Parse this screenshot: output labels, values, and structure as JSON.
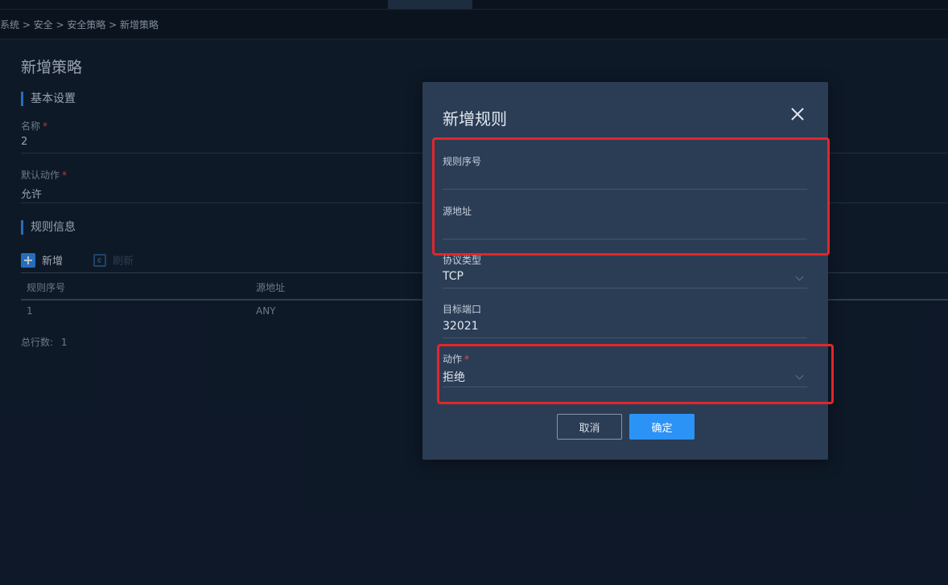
{
  "breadcrumb": "系统 > 安全 > 安全策略 > 新增策略",
  "page": {
    "title": "新增策略",
    "basic_section": "基本设置",
    "name_label": "名称",
    "name_value": "2",
    "default_action_label": "默认动作",
    "default_action_value": "允许",
    "required_mark": "*",
    "rules_section": "规则信息",
    "add_label": "新增",
    "refresh_label": "刷新",
    "table": {
      "headers": [
        "规则序号",
        "源地址"
      ],
      "rows": [
        [
          "1",
          "ANY"
        ]
      ]
    },
    "total_label": "总行数:",
    "total_value": "1"
  },
  "modal": {
    "title": "新增规则",
    "rule_no_label": "规则序号",
    "rule_no_value": "",
    "source_label": "源地址",
    "source_value": "",
    "protocol_label": "协议类型",
    "protocol_value": "TCP",
    "port_label": "目标端口",
    "port_value": "32021",
    "action_label": "动作",
    "action_value": "拒绝",
    "cancel_label": "取消",
    "ok_label": "确定"
  },
  "colors": {
    "accent": "#2c93f6",
    "highlight": "#e2262a",
    "required": "#e0504b"
  }
}
